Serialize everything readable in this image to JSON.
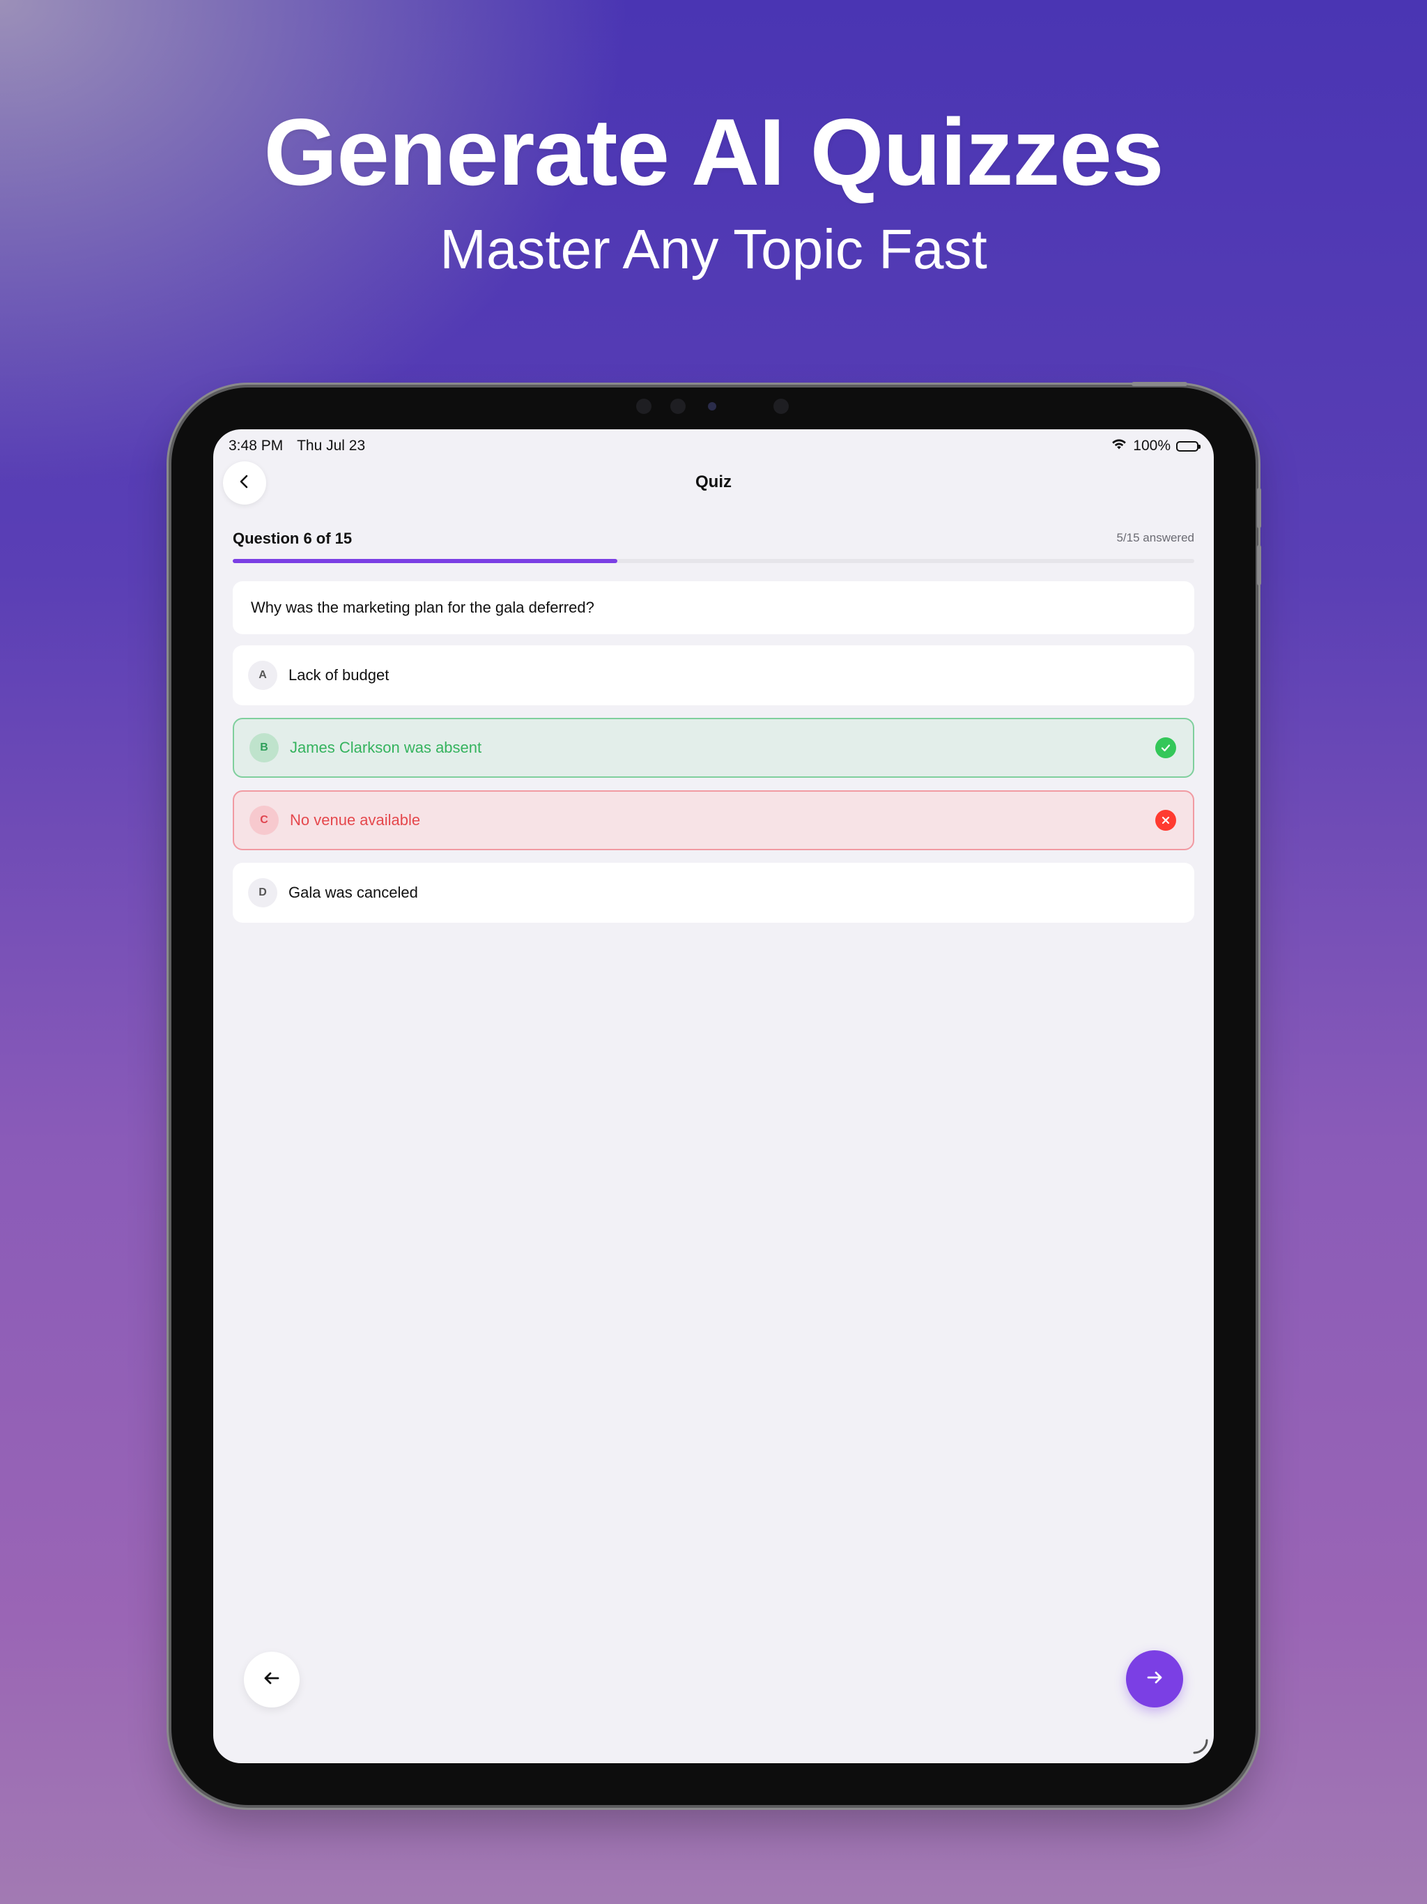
{
  "hero": {
    "title": "Generate AI Quizzes",
    "subtitle": "Master Any Topic Fast"
  },
  "status_bar": {
    "time": "3:48 PM",
    "date": "Thu Jul 23",
    "battery": "100%"
  },
  "nav": {
    "title": "Quiz"
  },
  "quiz": {
    "question_counter": "Question 6 of 15",
    "answered": "5/15 answered",
    "progress_fraction": 0.4,
    "question": "Why was the marketing plan for the gala deferred?",
    "options": [
      {
        "letter": "A",
        "label": "Lack of budget",
        "state": "default"
      },
      {
        "letter": "B",
        "label": "James Clarkson was absent",
        "state": "correct"
      },
      {
        "letter": "C",
        "label": "No venue available",
        "state": "wrong"
      },
      {
        "letter": "D",
        "label": "Gala was canceled",
        "state": "default"
      }
    ]
  },
  "colors": {
    "accent": "#7b3fe4",
    "correct": "#34c759",
    "wrong": "#ff3b30"
  },
  "icons": {
    "back": "chevron-left-icon",
    "prev": "arrow-left-icon",
    "next": "arrow-right-icon",
    "correct": "checkmark-circle-icon",
    "wrong": "xmark-circle-icon"
  }
}
